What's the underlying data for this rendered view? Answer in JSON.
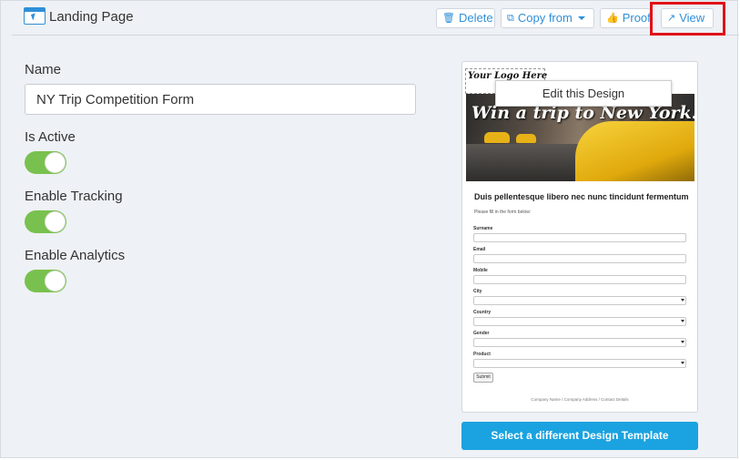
{
  "header": {
    "title": "Landing Page",
    "page_icon": "landing-page-icon",
    "buttons": {
      "delete": {
        "label": "Delete",
        "icon": "trash-icon"
      },
      "copy_from": {
        "label": "Copy from",
        "icon": "copy-icon"
      },
      "proof": {
        "label": "Proof",
        "icon": "thumbs-up-icon"
      },
      "view": {
        "label": "View",
        "icon": "external-link-icon"
      }
    },
    "highlight_color": "#e0121a"
  },
  "form": {
    "name_label": "Name",
    "name_value": "NY Trip Competition Form",
    "is_active": {
      "label": "Is Active",
      "on": true
    },
    "enable_tracking": {
      "label": "Enable Tracking",
      "on": true
    },
    "enable_analytics": {
      "label": "Enable Analytics",
      "on": true
    },
    "toggle_color": "#79c14e"
  },
  "preview": {
    "logo_text": "Your Logo Here",
    "edit_button": "Edit this Design",
    "headline": "Win a trip to New York!",
    "form_title": "Duis pellentesque libero nec nunc tincidunt fermentum",
    "form_intro": "Please fill in the form below:",
    "fields": [
      {
        "label": "Surname",
        "type": "text"
      },
      {
        "label": "Email",
        "type": "text"
      },
      {
        "label": "Mobile",
        "type": "text"
      },
      {
        "label": "City",
        "type": "select"
      },
      {
        "label": "Country",
        "type": "select"
      },
      {
        "label": "Gender",
        "type": "select"
      },
      {
        "label": "Product",
        "type": "select"
      }
    ],
    "submit_label": "Submit",
    "footer": "Company Name / Company Address / Contact Details"
  },
  "select_template_button": "Select a different Design Template",
  "accent_color": "#1aa3e0"
}
